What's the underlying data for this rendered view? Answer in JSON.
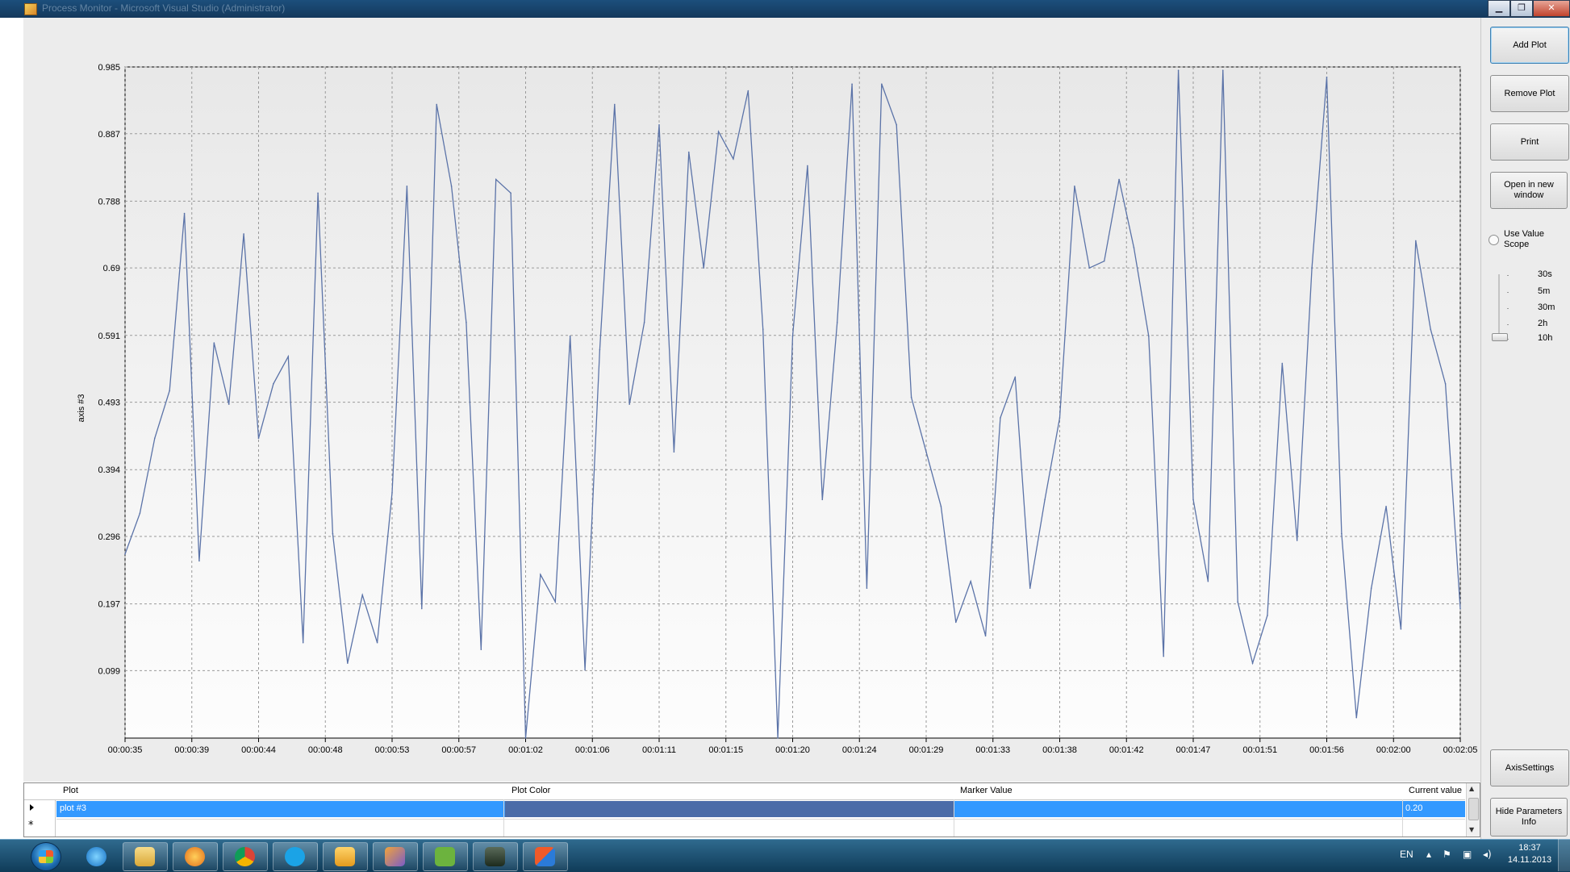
{
  "window": {
    "title": "Process Monitor - Microsoft Visual Studio (Administrator)",
    "controls": [
      "▁",
      "❐",
      "✕"
    ]
  },
  "chart_data": {
    "type": "line",
    "title": "",
    "xlabel": "",
    "ylabel": "axis #3",
    "ylim": [
      0.0,
      0.985
    ],
    "yticks": [
      "0.099",
      "0.197",
      "0.296",
      "0.394",
      "0.493",
      "0.591",
      "0.69",
      "0.788",
      "0.887",
      "0.985"
    ],
    "xticks": [
      "00:00:35",
      "00:00:39",
      "00:00:44",
      "00:00:48",
      "00:00:53",
      "00:00:57",
      "00:01:02",
      "00:01:06",
      "00:01:11",
      "00:01:15",
      "00:01:20",
      "00:01:24",
      "00:01:29",
      "00:01:33",
      "00:01:38",
      "00:01:42",
      "00:01:47",
      "00:01:51",
      "00:01:56",
      "00:02:00",
      "00:02:05"
    ],
    "x_range_seconds": [
      35,
      125
    ],
    "grid": true,
    "legend": "none",
    "series_color": "#5b73a8",
    "series": [
      {
        "name": "plot #3",
        "x": [
          35,
          36,
          37,
          38,
          39,
          40,
          41,
          42,
          43,
          44,
          45,
          46,
          47,
          48,
          49,
          50,
          51,
          52,
          53,
          54,
          55,
          56,
          57,
          58,
          59,
          60,
          61,
          62,
          63,
          64,
          65,
          66,
          67,
          68,
          69,
          70,
          71,
          72,
          73,
          74,
          75,
          76,
          77,
          78,
          79,
          80,
          81,
          82,
          83,
          84,
          85,
          86,
          87,
          88,
          89,
          90,
          91,
          92,
          93,
          94,
          95,
          96,
          97,
          98,
          99,
          100,
          101,
          102,
          103,
          104,
          105,
          106,
          107,
          108,
          109,
          110,
          111,
          112,
          113,
          114,
          115,
          116,
          117,
          118,
          119,
          120,
          121,
          122,
          123,
          124,
          125
        ],
        "values": [
          0.27,
          0.33,
          0.44,
          0.51,
          0.77,
          0.26,
          0.58,
          0.49,
          0.74,
          0.44,
          0.52,
          0.56,
          0.14,
          0.8,
          0.3,
          0.11,
          0.21,
          0.14,
          0.36,
          0.81,
          0.19,
          0.93,
          0.81,
          0.61,
          0.13,
          0.82,
          0.8,
          0.0,
          0.24,
          0.2,
          0.59,
          0.1,
          0.57,
          0.93,
          0.49,
          0.61,
          0.9,
          0.42,
          0.86,
          0.69,
          0.89,
          0.85,
          0.95,
          0.6,
          0.0,
          0.59,
          0.84,
          0.35,
          0.61,
          0.96,
          0.22,
          0.96,
          0.9,
          0.5,
          0.42,
          0.34,
          0.17,
          0.23,
          0.15,
          0.47,
          0.53,
          0.22,
          0.35,
          0.47,
          0.81,
          0.69,
          0.7,
          0.82,
          0.72,
          0.59,
          0.12,
          0.98,
          0.35,
          0.23,
          0.98,
          0.2,
          0.11,
          0.18,
          0.55,
          0.29,
          0.69,
          0.97,
          0.3,
          0.03,
          0.22,
          0.34,
          0.16,
          0.73,
          0.6,
          0.52,
          0.19
        ]
      }
    ]
  },
  "sidebar": {
    "add_plot": "Add Plot",
    "remove_plot": "Remove Plot",
    "print": "Print",
    "open_new_window": "Open in new window",
    "use_value_scope": "Use Value Scope",
    "scope_options": [
      "30s",
      "5m",
      "30m",
      "2h",
      "10h"
    ],
    "selected_scope": "10h",
    "axis_settings": "AxisSettings",
    "hide_params": "Hide Parameters Info"
  },
  "grid": {
    "columns": [
      "Plot",
      "Plot Color",
      "Marker Value",
      "Current value"
    ],
    "rows": [
      {
        "plot": "plot #3",
        "color": "#4b6ca8",
        "marker": "",
        "current": "0.20"
      }
    ],
    "new_row_marker": "*"
  },
  "taskbar": {
    "apps": [
      "internet-explorer",
      "file-explorer",
      "media-player",
      "chrome",
      "skype",
      "outlook",
      "tool",
      "evernote",
      "task-manager",
      "app"
    ],
    "language": "EN",
    "time": "18:37",
    "date": "14.11.2013"
  }
}
